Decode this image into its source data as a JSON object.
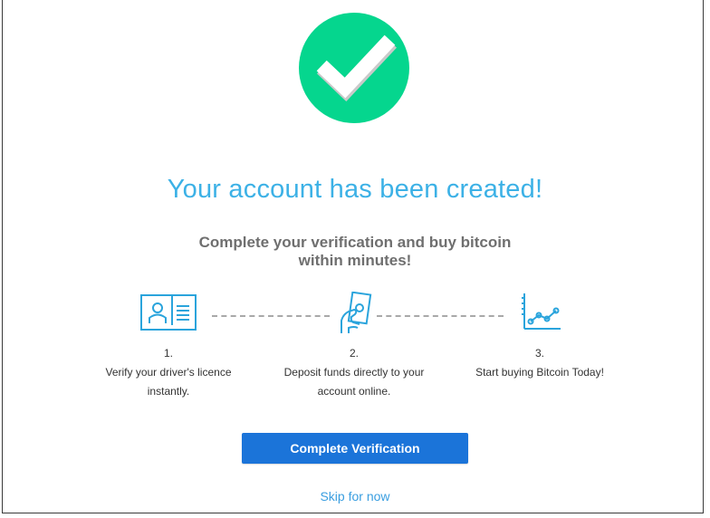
{
  "header": {
    "title": "Your account has been created!",
    "subtitle_line1": "Complete your verification and buy bitcoin",
    "subtitle_line2": "within minutes!"
  },
  "steps": [
    {
      "number": "1.",
      "line1": "Verify your driver's licence",
      "line2": "instantly.",
      "icon": "id-card-icon"
    },
    {
      "number": "2.",
      "line1": "Deposit funds directly to your",
      "line2": "account online.",
      "icon": "cash-hand-icon"
    },
    {
      "number": "3.",
      "line1": "Start buying Bitcoin Today!",
      "line2": "",
      "icon": "line-chart-icon"
    }
  ],
  "actions": {
    "primary_label": "Complete Verification",
    "skip_label": "Skip for now"
  },
  "colors": {
    "success": "#05d68e",
    "accent": "#3cb1e6",
    "primary_button": "#1b74d9"
  }
}
